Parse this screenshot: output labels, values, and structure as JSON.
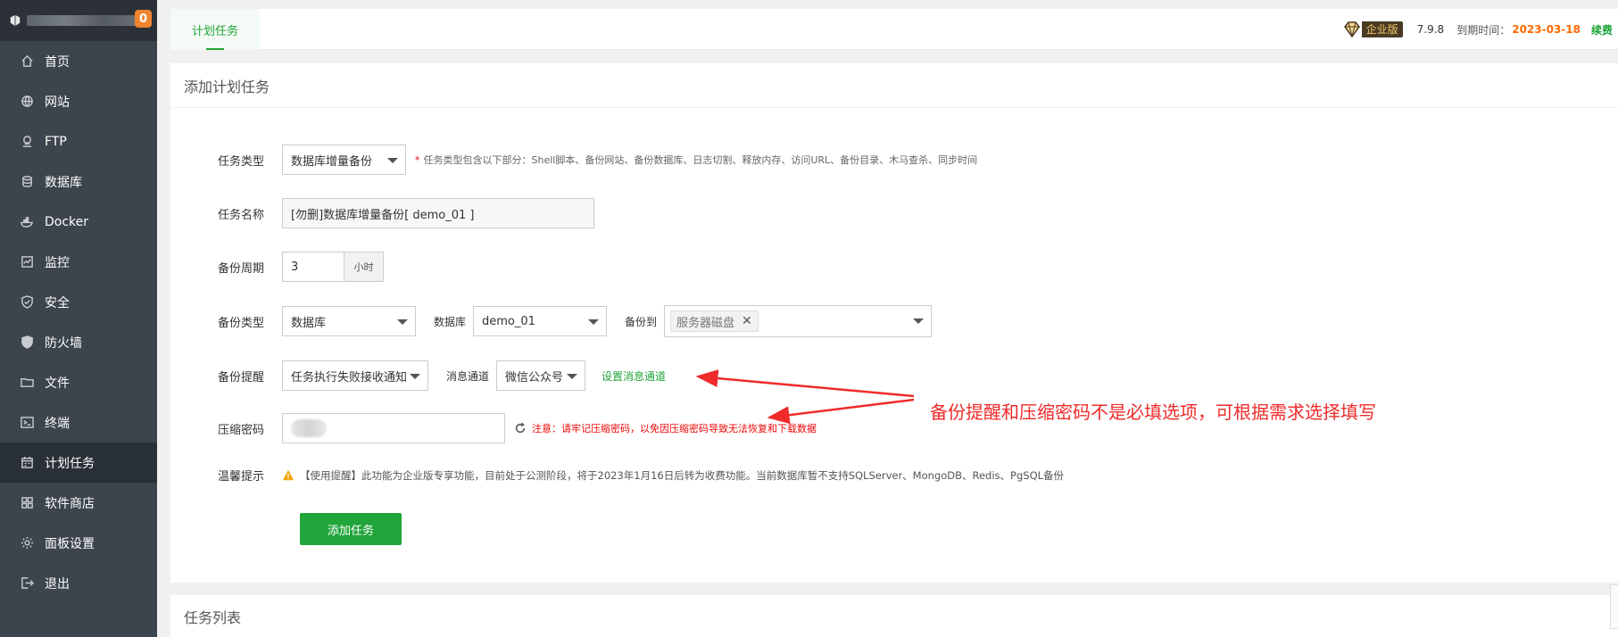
{
  "sidebar": {
    "badge": "0",
    "items": [
      {
        "label": "首页",
        "icon": "home-icon"
      },
      {
        "label": "网站",
        "icon": "globe-icon"
      },
      {
        "label": "FTP",
        "icon": "ftp-icon"
      },
      {
        "label": "数据库",
        "icon": "database-icon"
      },
      {
        "label": "Docker",
        "icon": "docker-icon"
      },
      {
        "label": "监控",
        "icon": "monitor-icon"
      },
      {
        "label": "安全",
        "icon": "shield-icon"
      },
      {
        "label": "防火墙",
        "icon": "firewall-icon"
      },
      {
        "label": "文件",
        "icon": "folder-icon"
      },
      {
        "label": "终端",
        "icon": "terminal-icon"
      },
      {
        "label": "计划任务",
        "icon": "calendar-icon",
        "active": true
      },
      {
        "label": "软件商店",
        "icon": "apps-icon"
      },
      {
        "label": "面板设置",
        "icon": "gear-icon"
      },
      {
        "label": "退出",
        "icon": "logout-icon"
      }
    ]
  },
  "topbar": {
    "tab_label": "计划任务",
    "edition_label": "企业版",
    "version": "7.9.8",
    "expire_label": "到期时间：",
    "expire_date": "2023-03-18",
    "renew_label": "续费"
  },
  "form": {
    "title": "添加计划任务",
    "task_type_label": "任务类型",
    "task_type_value": "数据库增量备份",
    "task_type_hint": "任务类型包含以下部分：Shell脚本、备份网站、备份数据库、日志切割、释放内存、访问URL、备份目录、木马查杀、同步时间",
    "task_name_label": "任务名称",
    "task_name_value": "[勿删]数据库增量备份[ demo_01 ]",
    "period_label": "备份周期",
    "period_value": "3",
    "period_unit": "小时",
    "backup_type_label": "备份类型",
    "backup_type_value": "数据库",
    "database_label": "数据库",
    "database_value": "demo_01",
    "backup_to_label": "备份到",
    "backup_to_tag": "服务器磁盘",
    "reminder_label": "备份提醒",
    "reminder_value": "任务执行失败接收通知",
    "channel_label": "消息通道",
    "channel_value": "微信公众号",
    "channel_link": "设置消息通道",
    "password_label": "压缩密码",
    "password_warning": "注意：请牢记压缩密码，以免因压缩密码导致无法恢复和下载数据",
    "tip_label": "温馨提示",
    "tip_text": "【使用提醒】此功能为企业版专享功能，目前处于公测阶段，将于2023年1月16日后转为收费功能。当前数据库暂不支持SQLServer、MongoDB、Redis、PgSQL备份",
    "submit_label": "添加任务"
  },
  "annotation": {
    "text": "备份提醒和压缩密码不是必填选项，可根据需求选择填写",
    "color": "#ef2b2b"
  },
  "task_list": {
    "title": "任务列表"
  },
  "colors": {
    "accent": "#20a53a",
    "sidebar_bg": "#3c444d",
    "expire": "#ff6a00",
    "warning": "#ef0808"
  }
}
